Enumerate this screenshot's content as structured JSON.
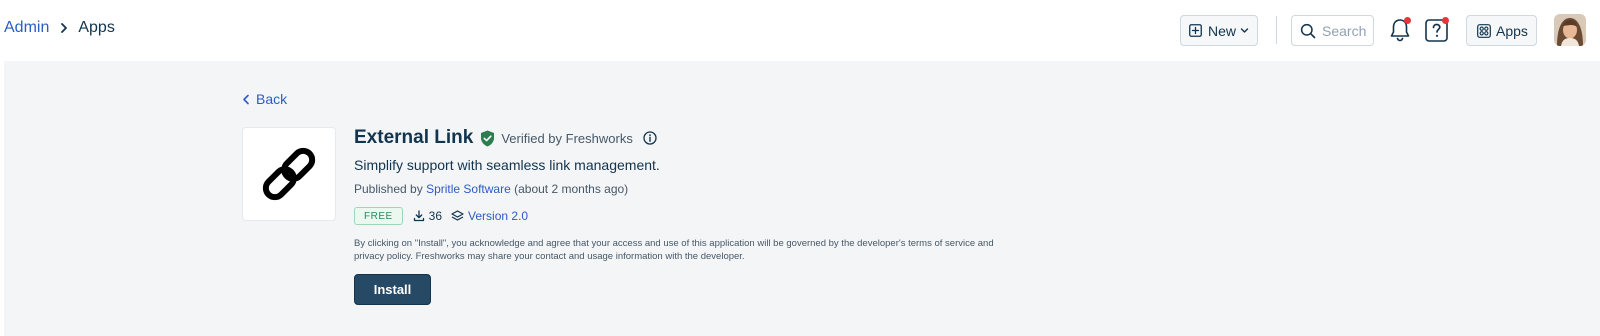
{
  "breadcrumb": {
    "parent": "Admin",
    "current": "Apps"
  },
  "header": {
    "new_label": "New",
    "search_placeholder": "Search",
    "apps_label": "Apps"
  },
  "colors": {
    "accent_link": "#2c5cc5",
    "primary_button": "#264966",
    "notification_dot": "#e43538",
    "verified_green": "#2e7d4f",
    "page_background": "#f3f5f7"
  },
  "icons": {
    "breadcrumb_separator": "chevron-right-icon",
    "new": "plus-square-icon",
    "new_dropdown": "chevron-down-icon",
    "search": "search-icon",
    "notifications": "bell-icon",
    "help": "help-icon",
    "apps": "apps-grid-icon",
    "back": "chevron-left-icon",
    "app_logo": "chain-link-icon",
    "verified": "shield-check-icon",
    "info": "info-icon",
    "downloads": "download-icon",
    "version": "layers-icon"
  },
  "back_label": "Back",
  "app": {
    "name": "External Link",
    "verified_text": "Verified by Freshworks",
    "tagline": "Simplify support with seamless link management.",
    "published_prefix": "Published by",
    "publisher": "Spritle Software",
    "published_suffix": "(about 2 months ago)",
    "price_badge": "FREE",
    "downloads": "36",
    "version": "Version 2.0",
    "disclaimer": "By clicking on \"Install\", you acknowledge and agree that your access and use of this application will be governed by the developer's terms of service and privacy policy. Freshworks may share your contact and usage information with the developer.",
    "install_label": "Install"
  }
}
